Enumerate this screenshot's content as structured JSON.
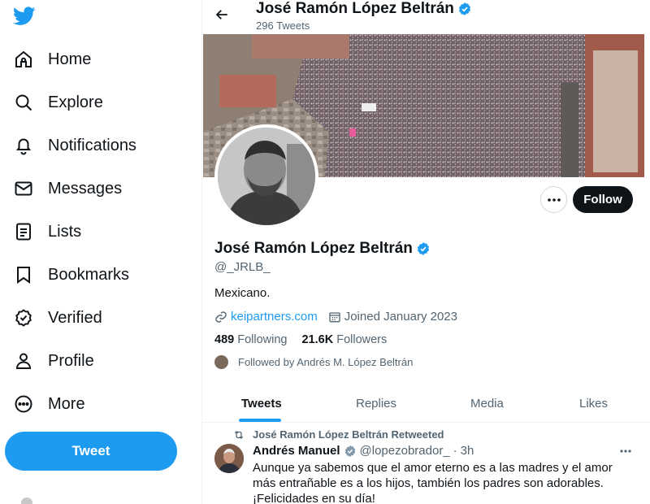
{
  "sidebar": {
    "logo_icon": "twitter-bird-icon",
    "items": [
      {
        "label": "Home",
        "icon": "home-icon"
      },
      {
        "label": "Explore",
        "icon": "search-icon"
      },
      {
        "label": "Notifications",
        "icon": "bell-icon"
      },
      {
        "label": "Messages",
        "icon": "envelope-icon"
      },
      {
        "label": "Lists",
        "icon": "list-icon"
      },
      {
        "label": "Bookmarks",
        "icon": "bookmark-icon"
      },
      {
        "label": "Verified",
        "icon": "verified-badge-icon"
      },
      {
        "label": "Profile",
        "icon": "person-icon"
      },
      {
        "label": "More",
        "icon": "more-circle-icon"
      }
    ],
    "tweet_button": "Tweet"
  },
  "header": {
    "name": "José Ramón López Beltrán",
    "tweet_count": "296 Tweets"
  },
  "profile": {
    "name": "José Ramón López Beltrán",
    "handle": "@_JRLB_",
    "bio": "Mexicano.",
    "website": "keipartners.com",
    "joined": "Joined January 2023",
    "following_count": "489",
    "following_label": "Following",
    "followers_count": "21.6K",
    "followers_label": "Followers",
    "followed_by": "Followed by Andrés M. López Beltrán",
    "follow_button": "Follow"
  },
  "tabs": [
    {
      "label": "Tweets",
      "active": true
    },
    {
      "label": "Replies",
      "active": false
    },
    {
      "label": "Media",
      "active": false
    },
    {
      "label": "Likes",
      "active": false
    }
  ],
  "tweet": {
    "retweet_note": "José Ramón López Beltrán Retweeted",
    "author": "Andrés Manuel",
    "handle": "@lopezobrador_",
    "separator": "·",
    "time": "3h",
    "text": "Aunque ya sabemos que el amor eterno es a las madres y el amor más entrañable es a los hijos, también los padres son adorables. ¡Felicidades en su día!"
  },
  "colors": {
    "accent": "#1d9bf0",
    "text": "#0f1419",
    "muted": "#536471",
    "follow_button_bg": "#0f1419"
  }
}
